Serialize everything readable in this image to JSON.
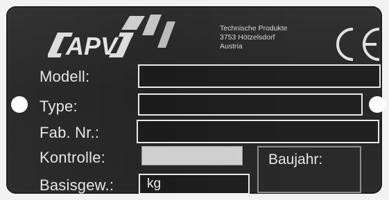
{
  "brand": {
    "logo_text": "APV"
  },
  "manufacturer": {
    "line1": "Technische Produkte",
    "line2": "3753 Hötzelsdorf",
    "line3": "Austria"
  },
  "certification": {
    "mark": "CE"
  },
  "fields": {
    "modell_label": "Modell:",
    "type_label": "Type:",
    "fab_nr_label": "Fab. Nr.:",
    "kontrolle_label": "Kontrolle:",
    "baujahr_label": "Baujahr:",
    "basisgew_label": "Basisgew.:",
    "basisgew_unit": "kg"
  },
  "colors": {
    "plate": "#262626",
    "text": "#e6e6e6",
    "field_border": "#eaeaea",
    "kontrolle_fill": "#cfcfcf"
  }
}
